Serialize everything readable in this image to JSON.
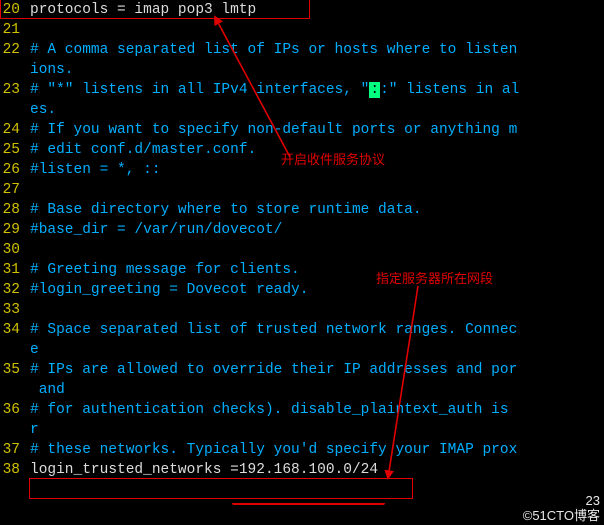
{
  "lines": [
    {
      "n": "20",
      "cls": "c-cfg",
      "t": "protocols = imap pop3 lmtp"
    },
    {
      "n": "21",
      "cls": "c-cfg",
      "t": ""
    },
    {
      "n": "22",
      "cls": "c-cmt",
      "t": "# A comma separated list of IPs or hosts where to listen"
    },
    {
      "n": "",
      "cls": "c-cmt",
      "t": "ions."
    },
    {
      "n": "23",
      "cls": "c-cmt",
      "t": "# \"*\" listens in all IPv4 interfaces, \"",
      "tail": ":\" listens in al",
      "hl": ":"
    },
    {
      "n": "",
      "cls": "c-cmt",
      "t": "es."
    },
    {
      "n": "24",
      "cls": "c-cmt",
      "t": "# If you want to specify non-default ports or anything m"
    },
    {
      "n": "25",
      "cls": "c-cmt",
      "t": "# edit conf.d/master.conf."
    },
    {
      "n": "26",
      "cls": "c-cmt",
      "t": "#listen = *, ::"
    },
    {
      "n": "27",
      "cls": "c-cfg",
      "t": ""
    },
    {
      "n": "28",
      "cls": "c-cmt",
      "t": "# Base directory where to store runtime data."
    },
    {
      "n": "29",
      "cls": "c-cmt",
      "t": "#base_dir = /var/run/dovecot/"
    },
    {
      "n": "30",
      "cls": "c-cfg",
      "t": ""
    },
    {
      "n": "31",
      "cls": "c-cmt",
      "t": "# Greeting message for clients."
    },
    {
      "n": "32",
      "cls": "c-cmt",
      "t": "#login_greeting = Dovecot ready."
    },
    {
      "n": "33",
      "cls": "c-cfg",
      "t": ""
    },
    {
      "n": "34",
      "cls": "c-cmt",
      "t": "# Space separated list of trusted network ranges. Connec"
    },
    {
      "n": "",
      "cls": "c-cmt",
      "t": "e"
    },
    {
      "n": "35",
      "cls": "c-cmt",
      "t": "# IPs are allowed to override their IP addresses and por"
    },
    {
      "n": "",
      "cls": "c-cmt",
      "t": " and"
    },
    {
      "n": "36",
      "cls": "c-cmt",
      "t": "# for authentication checks). disable_plaintext_auth is "
    },
    {
      "n": "",
      "cls": "c-cmt",
      "t": "r"
    },
    {
      "n": "37",
      "cls": "c-cmt",
      "t": "# these networks. Typically you'd specify your IMAP prox"
    },
    {
      "n": "38",
      "cls": "c-cfg",
      "t": "login_trusted_networks =192.168.100.0/24"
    }
  ],
  "annotations": {
    "a1": "开启收件服务协议",
    "a2": "指定服务器所在网段"
  },
  "footer": {
    "page": "23",
    "site": "©51CTO博客"
  }
}
